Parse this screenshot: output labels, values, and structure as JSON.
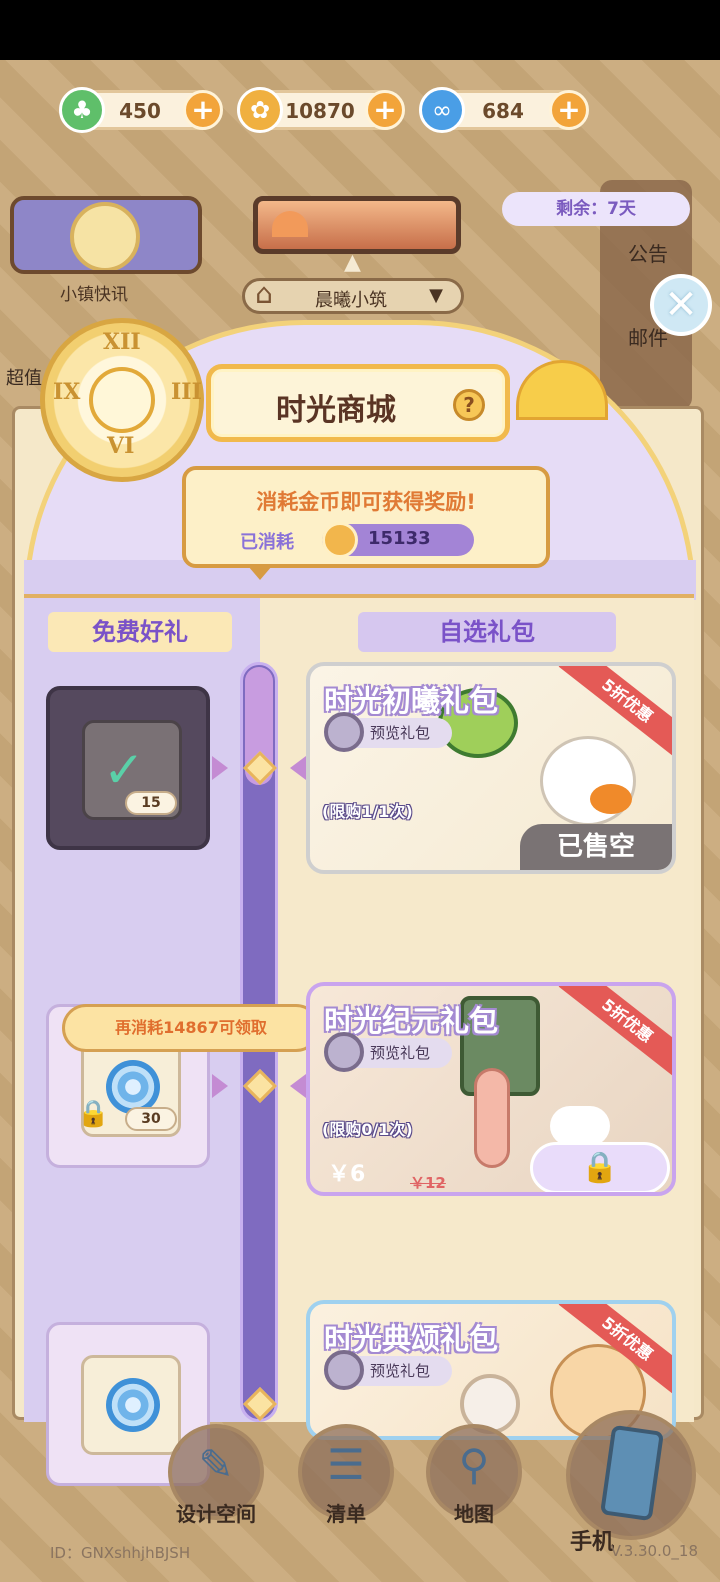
{
  "currencies": [
    {
      "name": "clover-currency",
      "value": "450",
      "color": "#5fbf6a"
    },
    {
      "name": "coin-currency",
      "value": "10870",
      "color": "#f0b040"
    },
    {
      "name": "swirl-currency",
      "value": "684",
      "color": "#4a9ee6"
    }
  ],
  "top": {
    "news_label": "小镇快讯",
    "location": "晨曦小筑",
    "remaining": "剩余：7天",
    "notice": "公告",
    "mail": "邮件",
    "cheap_label": "超值"
  },
  "shop": {
    "title": "时光商城",
    "help": "?",
    "reward_head": "消耗金币即可获得奖励!",
    "used_label": "已消耗",
    "used_value": "15133",
    "free_label": "免费好礼",
    "pick_label": "自选礼包",
    "consume_tip": "再消耗14867可领取",
    "free_slots": [
      {
        "count": "15",
        "state": "claimed"
      },
      {
        "count": "30",
        "state": "locked"
      },
      {
        "count": "",
        "state": "locked"
      }
    ],
    "packs": [
      {
        "name": "时光初曦礼包",
        "preview": "预览礼包",
        "badge": "5折优惠",
        "limit": "(限购1/1次)",
        "status": "已售空"
      },
      {
        "name": "时光纪元礼包",
        "preview": "预览礼包",
        "badge": "5折优惠",
        "limit": "(限购0/1次)",
        "price": "￥6",
        "orig_price": "￥12"
      },
      {
        "name": "时光典颂礼包",
        "preview": "预览礼包",
        "badge": "5折优惠"
      }
    ]
  },
  "nav": {
    "design": "设计空间",
    "list": "清单",
    "map": "地图",
    "phone": "手机"
  },
  "footer": {
    "uid": "ID：GNXshhjhBJSH",
    "version": "V.3.30.0_18"
  }
}
